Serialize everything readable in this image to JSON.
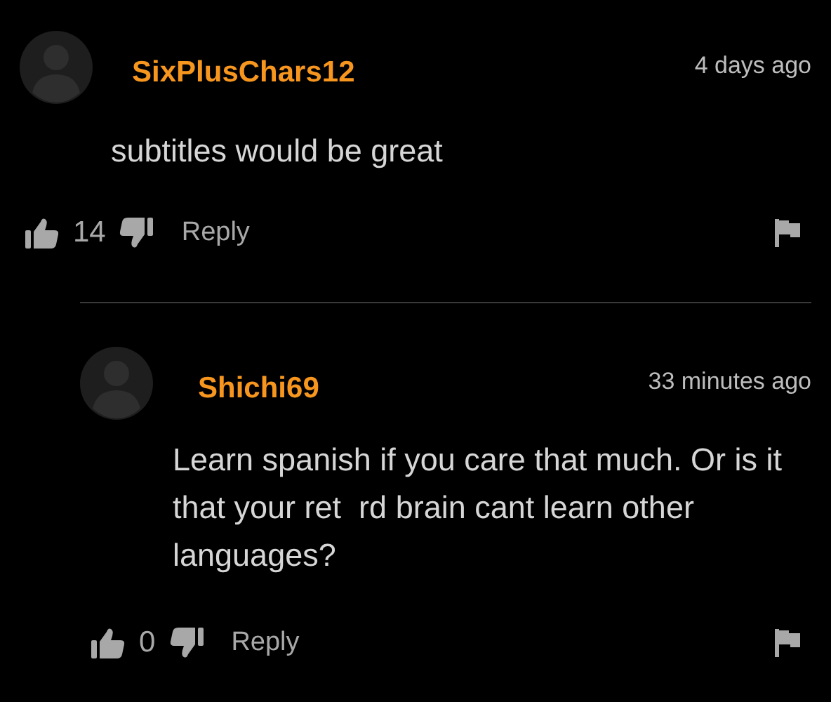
{
  "comments": [
    {
      "author": "SixPlusChars12",
      "time": "4 days ago",
      "text": "subtitles would be great",
      "likes": "14",
      "reply_label": "Reply",
      "replies": [
        {
          "author": "Shichi69",
          "time": "33 minutes ago",
          "text": "Learn spanish if you care that much. Or is it that your ret  rd brain cant learn other languages?",
          "likes": "0",
          "reply_label": "Reply"
        }
      ]
    }
  ]
}
